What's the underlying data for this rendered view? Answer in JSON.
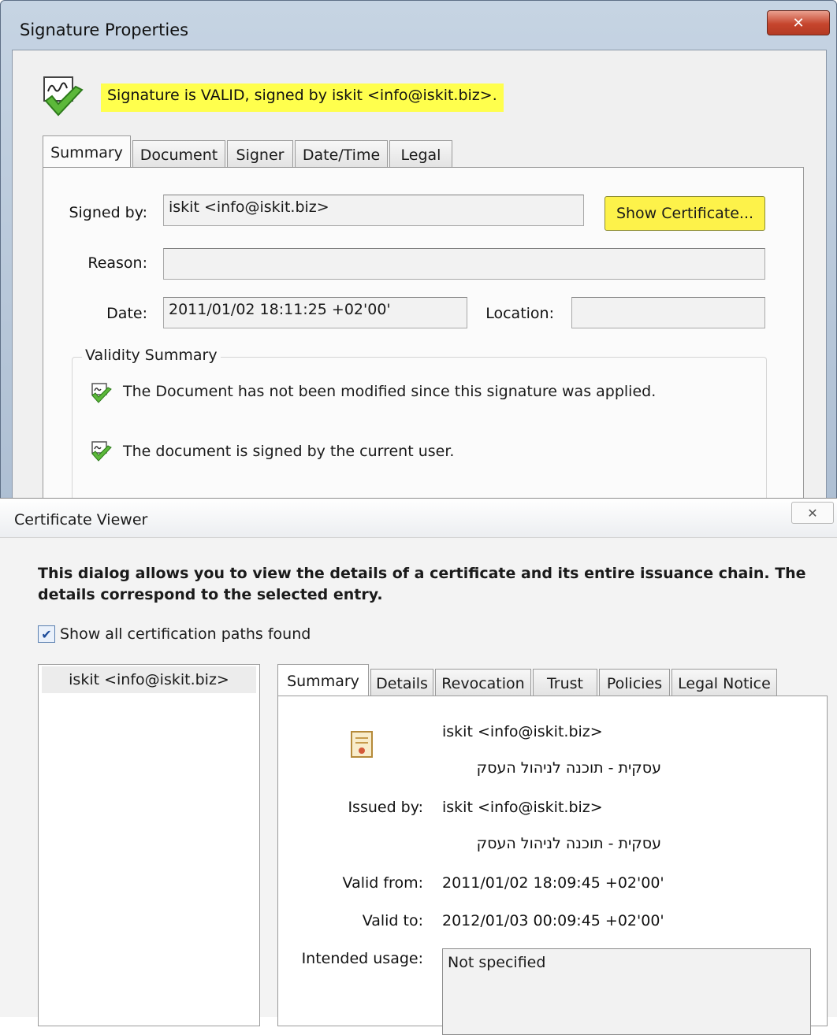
{
  "signature_properties": {
    "window_title": "Signature Properties",
    "close_glyph": "✕",
    "status_banner": "Signature is VALID, signed by iskit <info@iskit.biz>.",
    "tabs": [
      {
        "label": "Summary",
        "active": true
      },
      {
        "label": "Document"
      },
      {
        "label": "Signer"
      },
      {
        "label": "Date/Time"
      },
      {
        "label": "Legal"
      }
    ],
    "fields": {
      "signed_by_label": "Signed by:",
      "signed_by_value": "iskit <info@iskit.biz>",
      "show_certificate_label": "Show Certificate...",
      "reason_label": "Reason:",
      "reason_value": "",
      "date_label": "Date:",
      "date_value": "2011/01/02 18:11:25 +02'00'",
      "location_label": "Location:",
      "location_value": ""
    },
    "validity_summary": {
      "legend": "Validity Summary",
      "items": [
        "The Document has not been modified since this signature was applied.",
        "The document is signed by the current user."
      ]
    },
    "highlight_color": "#ffff4d"
  },
  "certificate_viewer": {
    "window_title": "Certificate Viewer",
    "close_glyph": "✕",
    "description": "This dialog allows you to view the details of a certificate and its entire issuance chain. The details correspond to the selected entry.",
    "show_all_paths": {
      "label": "Show all certification paths found",
      "checked": true,
      "check_glyph": "✔"
    },
    "tree_items": [
      "iskit <info@iskit.biz>"
    ],
    "tabs": [
      {
        "label": "Summary",
        "active": true
      },
      {
        "label": "Details"
      },
      {
        "label": "Revocation"
      },
      {
        "label": "Trust"
      },
      {
        "label": "Policies"
      },
      {
        "label": "Legal Notice"
      }
    ],
    "summary": {
      "subject_name": "iskit <info@iskit.biz>",
      "subject_org": "עסקית - תוכנה לניהול העסק",
      "issued_by_label": "Issued by:",
      "issuer_name": "iskit <info@iskit.biz>",
      "issuer_org": "עסקית - תוכנה לניהול העסק",
      "valid_from_label": "Valid from:",
      "valid_from": "2011/01/02 18:09:45 +02'00'",
      "valid_to_label": "Valid to:",
      "valid_to": "2012/01/03 00:09:45 +02'00'",
      "intended_usage_label": "Intended usage:",
      "intended_usage": "Not specified"
    }
  }
}
